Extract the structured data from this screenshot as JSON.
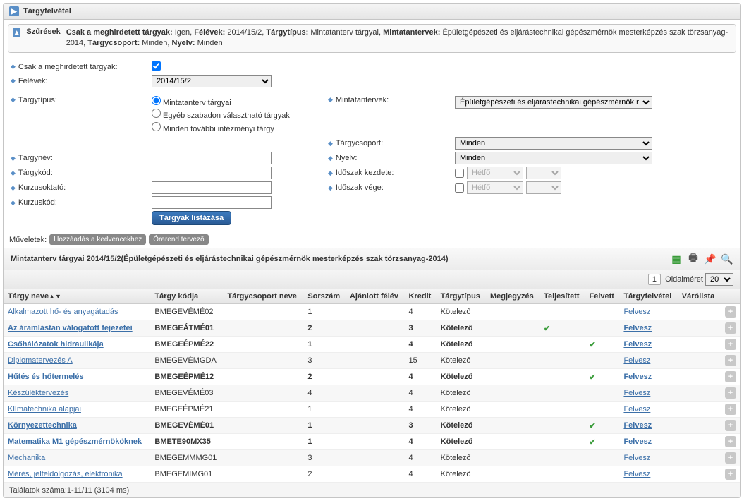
{
  "header": {
    "title": "Tárgyfelvétel"
  },
  "filters_label": "Szűrések",
  "filter_summary": [
    {
      "k": "Csak a meghirdetett tárgyak",
      "v": "Igen"
    },
    {
      "k": "Félévek",
      "v": "2014/15/2"
    },
    {
      "k": "Tárgytípus",
      "v": "Mintatanterv tárgyai"
    },
    {
      "k": "Mintatantervek",
      "v": "Épületgépészeti és eljárástechnikai gépészmérnök mesterképzés szak törzsanyag-2014"
    },
    {
      "k": "Tárgycsoport",
      "v": "Minden"
    },
    {
      "k": "Nyelv",
      "v": "Minden"
    }
  ],
  "form": {
    "only_announced": "Csak a meghirdetett tárgyak:",
    "semesters": "Félévek:",
    "semester_value": "2014/15/2",
    "subject_type": "Tárgytípus:",
    "type_opts": [
      "Mintatanterv tárgyai",
      "Egyéb szabadon választható tárgyak",
      "Minden további intézményi tárgy"
    ],
    "curriculum_label": "Mintatantervek:",
    "curriculum_value": "Épületgépészeti és eljárástechnikai gépészmérnök mesterképzé",
    "group_label": "Tárgycsoport:",
    "group_value": "Minden",
    "lang_label": "Nyelv:",
    "lang_value": "Minden",
    "period_start": "Időszak kezdete:",
    "period_end": "Időszak vége:",
    "period_day": "Hétfő",
    "subject_name": "Tárgynév:",
    "subject_code": "Tárgykód:",
    "course_teacher": "Kurzusoktató:",
    "course_code": "Kurzuskód:",
    "list_btn": "Tárgyak listázása"
  },
  "ops": {
    "label": "Műveletek:",
    "fav": "Hozzáadás a kedvencekhez",
    "sched": "Órarend tervező"
  },
  "list_title": "Mintatanterv tárgyai 2014/15/2(Épületgépészeti és eljárástechnikai gépészmérnök mesterképzés szak törzsanyag-2014)",
  "pager": {
    "page": "1",
    "size_label": "Oldalméret",
    "size": "20"
  },
  "cols": [
    "Tárgy neve",
    "Tárgy kódja",
    "Tárgycsoport neve",
    "Sorszám",
    "Ajánlott félév",
    "Kredit",
    "Tárgytípus",
    "Megjegyzés",
    "Teljesített",
    "Felvett",
    "Tárgyfelvétel",
    "Várólista",
    ""
  ],
  "rows": [
    {
      "name": "Alkalmazott hő- és anyagátadás",
      "code": "BMEGEVÉMÉ02",
      "sor": "1",
      "felev": "",
      "kredit": "4",
      "tip": "Kötelező",
      "telj": "",
      "felv": "",
      "link": "Felvesz",
      "bold": false
    },
    {
      "name": "Az áramlástan válogatott fejezetei",
      "code": "BMEGEÁTMÉ01",
      "sor": "2",
      "felev": "",
      "kredit": "3",
      "tip": "Kötelező",
      "telj": "✓",
      "felv": "",
      "link": "Felvesz",
      "bold": true
    },
    {
      "name": "Csőhálózatok hidraulikája",
      "code": "BMEGEÉPMÉ22",
      "sor": "1",
      "felev": "",
      "kredit": "4",
      "tip": "Kötelező",
      "telj": "",
      "felv": "✓",
      "link": "Felvesz",
      "bold": true
    },
    {
      "name": "Diplomatervezés A",
      "code": "BMEGEVÉMGDA",
      "sor": "3",
      "felev": "",
      "kredit": "15",
      "tip": "Kötelező",
      "telj": "",
      "felv": "",
      "link": "Felvesz",
      "bold": false
    },
    {
      "name": "Hűtés és hőtermelés",
      "code": "BMEGEÉPMÉ12",
      "sor": "2",
      "felev": "",
      "kredit": "4",
      "tip": "Kötelező",
      "telj": "",
      "felv": "✓",
      "link": "Felvesz",
      "bold": true
    },
    {
      "name": "Készüléktervezés",
      "code": "BMEGEVÉMÉ03",
      "sor": "4",
      "felev": "",
      "kredit": "4",
      "tip": "Kötelező",
      "telj": "",
      "felv": "",
      "link": "Felvesz",
      "bold": false
    },
    {
      "name": "Klímatechnika alapjai",
      "code": "BMEGEÉPMÉ21",
      "sor": "1",
      "felev": "",
      "kredit": "4",
      "tip": "Kötelező",
      "telj": "",
      "felv": "",
      "link": "Felvesz",
      "bold": false
    },
    {
      "name": "Környezettechnika",
      "code": "BMEGEVÉMÉ01",
      "sor": "1",
      "felev": "",
      "kredit": "3",
      "tip": "Kötelező",
      "telj": "",
      "felv": "✓",
      "link": "Felvesz",
      "bold": true
    },
    {
      "name": "Matematika M1 gépészmérnököknek",
      "code": "BMETE90MX35",
      "sor": "1",
      "felev": "",
      "kredit": "4",
      "tip": "Kötelező",
      "telj": "",
      "felv": "✓",
      "link": "Felvesz",
      "bold": true
    },
    {
      "name": "Mechanika",
      "code": "BMEGEMMMG01",
      "sor": "3",
      "felev": "",
      "kredit": "4",
      "tip": "Kötelező",
      "telj": "",
      "felv": "",
      "link": "Felvesz",
      "bold": false
    },
    {
      "name": "Mérés, jelfeldolgozás, elektronika",
      "code": "BMEGEMIMG01",
      "sor": "2",
      "felev": "",
      "kredit": "4",
      "tip": "Kötelező",
      "telj": "",
      "felv": "",
      "link": "Felvesz",
      "bold": false
    }
  ],
  "footer": "Találatok száma:1-11/11 (3104 ms)"
}
